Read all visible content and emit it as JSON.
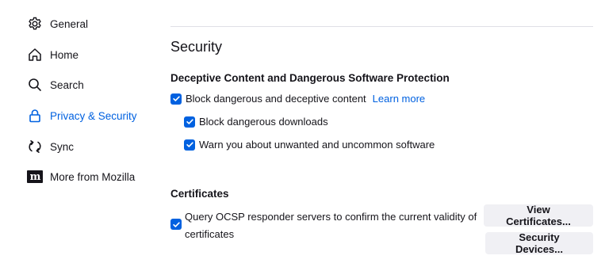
{
  "sidebar": {
    "items": [
      {
        "label": "General",
        "icon": "gear-icon"
      },
      {
        "label": "Home",
        "icon": "home-icon"
      },
      {
        "label": "Search",
        "icon": "search-icon"
      },
      {
        "label": "Privacy & Security",
        "icon": "lock-icon",
        "selected": true
      },
      {
        "label": "Sync",
        "icon": "sync-icon"
      },
      {
        "label": "More from Mozilla",
        "icon": "mozilla-icon",
        "glyph": "m"
      }
    ]
  },
  "section": {
    "title": "Security",
    "deceptive": {
      "title": "Deceptive Content and Dangerous Software Protection",
      "block_content": {
        "label": "Block dangerous and deceptive content",
        "checked": true
      },
      "learn_more": "Learn more",
      "block_downloads": {
        "label": "Block dangerous downloads",
        "checked": true
      },
      "warn_unwanted": {
        "label": "Warn you about unwanted and uncommon software",
        "checked": true
      }
    },
    "certificates": {
      "title": "Certificates",
      "query_ocsp": {
        "label": "Query OCSP responder servers to confirm the current validity of certificates",
        "checked": true
      },
      "view_certificates": "View Certificates...",
      "security_devices": "Security Devices..."
    }
  },
  "colors": {
    "accent": "#0061e0",
    "text": "#15141a",
    "button_bg": "#f0f0f4"
  }
}
